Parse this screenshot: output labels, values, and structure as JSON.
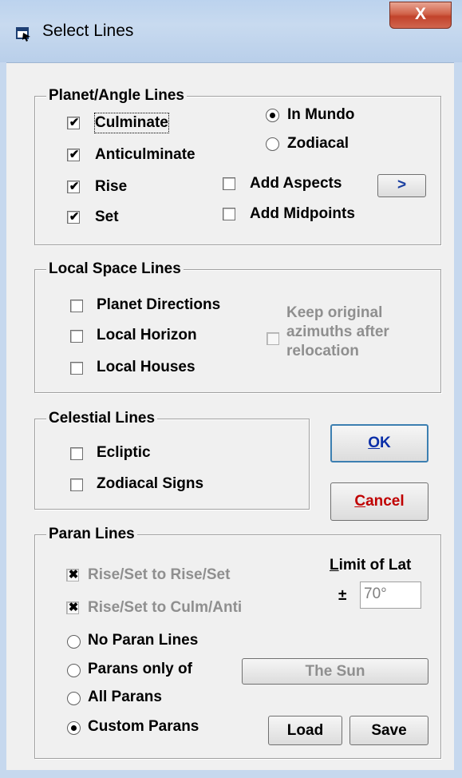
{
  "window": {
    "title": "Select Lines",
    "close_glyph": "X"
  },
  "planet_angle": {
    "label": "Planet/Angle Lines",
    "checks": [
      {
        "label": "Culminate",
        "checked": true
      },
      {
        "label": "Anticulminate",
        "checked": true
      },
      {
        "label": "Rise",
        "checked": true
      },
      {
        "label": "Set",
        "checked": true
      }
    ],
    "radios": [
      {
        "label": "In Mundo",
        "selected": true
      },
      {
        "label": "Zodiacal",
        "selected": false
      }
    ],
    "add_aspects": {
      "label": "Add Aspects",
      "checked": false
    },
    "add_midpoints": {
      "label": "Add Midpoints",
      "checked": false
    },
    "aspects_button": ">"
  },
  "local_space": {
    "label": "Local Space Lines",
    "checks": [
      {
        "label": "Planet Directions",
        "checked": false
      },
      {
        "label": "Local Horizon",
        "checked": false
      },
      {
        "label": "Local Houses",
        "checked": false
      }
    ],
    "keep_azimuths": {
      "line1": "Keep original",
      "line2": "azimuths after",
      "line3": "relocation",
      "checked": false
    }
  },
  "celestial": {
    "label": "Celestial Lines",
    "checks": [
      {
        "label": "Ecliptic",
        "checked": false
      },
      {
        "label": "Zodiacal Signs",
        "checked": false
      }
    ]
  },
  "buttons": {
    "ok_first": "O",
    "ok_rest": "K",
    "cancel_first": "C",
    "cancel_rest": "ancel"
  },
  "paran": {
    "label": "Paran Lines",
    "rise_set_rise_set": {
      "label": "Rise/Set to Rise/Set",
      "checked": true
    },
    "rise_set_culm": {
      "label": "Rise/Set to Culm/Anti",
      "checked": true
    },
    "limit_label_first": "L",
    "limit_label_rest": "imit of Lat",
    "plusminus": "±",
    "limit_value": "70°",
    "radios": [
      {
        "label": "No Paran Lines",
        "selected": false
      },
      {
        "label": "Parans only of",
        "selected": false
      },
      {
        "label": "All Parans",
        "selected": false
      },
      {
        "label": "Custom Parans",
        "selected": true
      }
    ],
    "the_sun": "The Sun",
    "load": "Load",
    "save": "Save",
    "check_glyph": "✔",
    "x_glyph": "✖"
  }
}
